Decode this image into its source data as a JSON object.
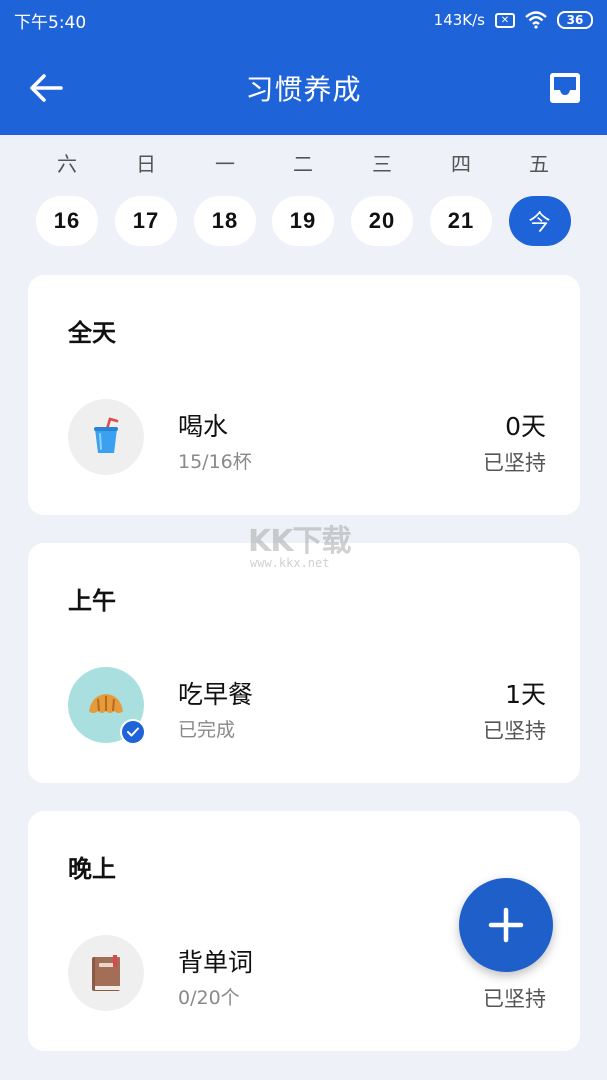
{
  "status_bar": {
    "time": "下午5:40",
    "network_speed": "143K/s",
    "sim_icon": "x-box-icon",
    "wifi_icon": "wifi-icon",
    "battery": "36"
  },
  "header": {
    "title": "习惯养成",
    "back_icon": "arrow-left-icon",
    "inbox_icon": "inbox-icon"
  },
  "week": {
    "days": [
      "六",
      "日",
      "一",
      "二",
      "三",
      "四",
      "五"
    ],
    "dates": [
      "16",
      "17",
      "18",
      "19",
      "20",
      "21",
      "今"
    ],
    "selected_index": 6
  },
  "sections": [
    {
      "title": "全天",
      "habits": [
        {
          "name": "喝水",
          "sub": "15/16杯",
          "days": "0天",
          "label": "已坚持",
          "icon": "cup-icon",
          "done": false
        }
      ]
    },
    {
      "title": "上午",
      "habits": [
        {
          "name": "吃早餐",
          "sub": "已完成",
          "days": "1天",
          "label": "已坚持",
          "icon": "croissant-icon",
          "done": true
        }
      ]
    },
    {
      "title": "晚上",
      "habits": [
        {
          "name": "背单词",
          "sub": "0/20个",
          "days": "",
          "label": "已坚持",
          "icon": "book-icon",
          "done": false
        }
      ]
    }
  ],
  "watermark": {
    "text": "KK下载",
    "url": "www.kkx.net"
  },
  "fab": {
    "icon": "plus-icon"
  },
  "colors": {
    "primary": "#1f63d8",
    "background": "#eef2f8",
    "card": "#ffffff",
    "teal": "#a9e0df"
  }
}
